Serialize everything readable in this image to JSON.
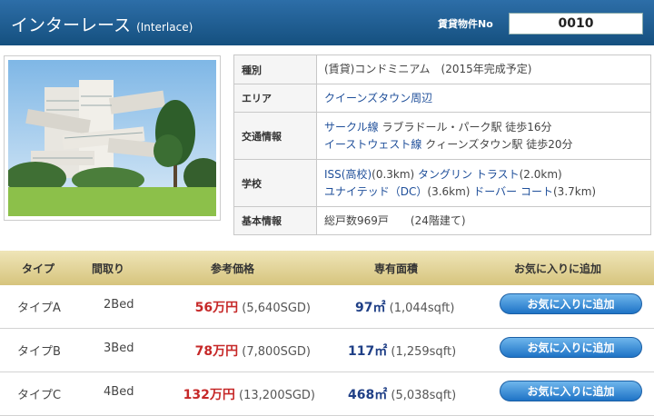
{
  "header": {
    "title": "インターレース",
    "title_en": "(Interlace)",
    "property_no_label": "賃貸物件No",
    "property_no": "0010"
  },
  "details": [
    {
      "key": "種別",
      "lines": [
        "(賃貸)コンドミニアム　(2015年完成予定)"
      ]
    },
    {
      "key": "エリア",
      "lines": [
        "クイーンズタウン周辺"
      ]
    },
    {
      "key": "交通情報",
      "lines": [
        "サークル線 ラブラドール・パーク駅 徒歩16分",
        "イーストウェスト線 クィーンズタウン駅 徒歩20分"
      ]
    },
    {
      "key": "学校",
      "lines": [
        "ISS(高校)(0.3km) タングリン トラスト(2.0km)",
        "ユナイテッド（DC）(3.6km) ドーバー コート(3.7km)"
      ]
    },
    {
      "key": "基本情報",
      "lines": [
        "総戸数969戸　　(24階建て)"
      ]
    }
  ],
  "links": {
    "area": "クイーンズタウン周辺",
    "circle_line": "サークル線",
    "circle_rest": " ラブラドール・パーク駅 徒歩16分",
    "ew_line": "イーストウェスト線",
    "ew_rest": " クィーンズタウン駅 徒歩20分",
    "school1": "ISS(高校)",
    "school1_dist": "(0.3km) ",
    "school2": "タングリン トラスト",
    "school2_dist": "(2.0km)",
    "school3": "ユナイテッド（DC）",
    "school3_dist": "(3.6km) ",
    "school4": "ドーバー コート",
    "school4_dist": "(3.7km)"
  },
  "table": {
    "headers": [
      "タイプ",
      "間取り",
      "参考価格",
      "専有面積",
      "お気に入りに追加"
    ],
    "rows": [
      {
        "type": "タイプA",
        "layout": "2Bed",
        "price": "56万円",
        "price_sgd": "(5,640SGD)",
        "area": "97㎡",
        "area_sqft": "(1,044sqft)",
        "fav": "お気に入りに追加"
      },
      {
        "type": "タイプB",
        "layout": "3Bed",
        "price": "78万円",
        "price_sgd": "(7,800SGD)",
        "area": "117㎡",
        "area_sqft": "(1,259sqft)",
        "fav": "お気に入りに追加"
      },
      {
        "type": "タイプC",
        "layout": "4Bed",
        "price": "132万円",
        "price_sgd": "(13,200SGD)",
        "area": "468㎡",
        "area_sqft": "(5,038sqft)",
        "fav": "お気に入りに追加"
      }
    ]
  }
}
